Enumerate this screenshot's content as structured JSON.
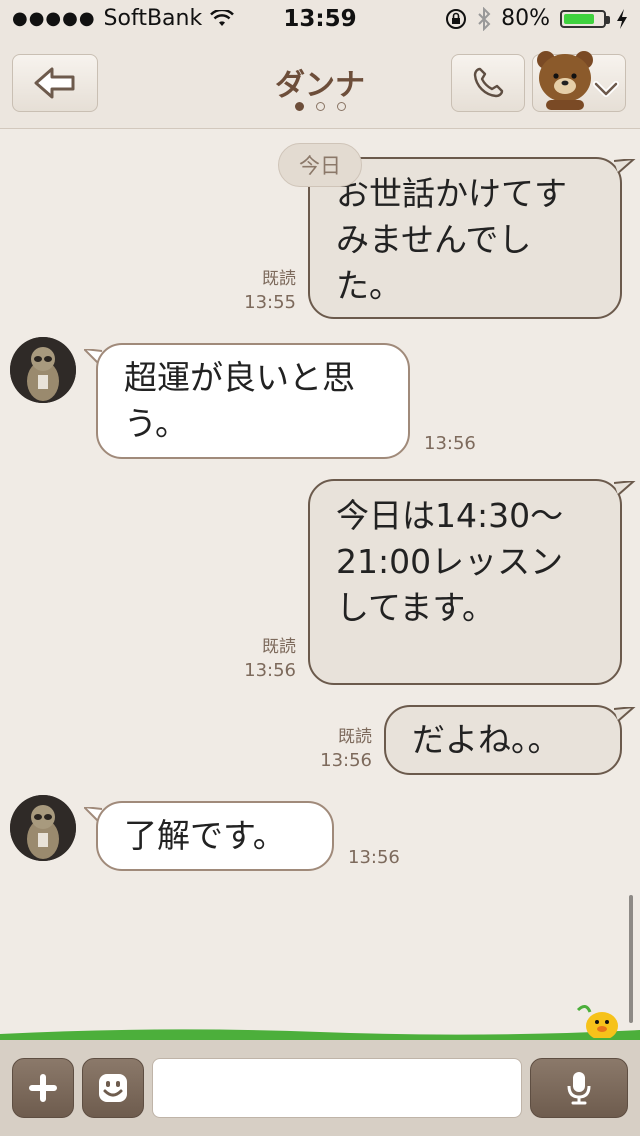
{
  "status_bar": {
    "signal_dots": "●●●●●",
    "carrier": "SoftBank",
    "time": "13:59",
    "battery_percent": "80%",
    "battery_level": 0.8,
    "icons": [
      "wifi-icon",
      "rotation-lock-icon",
      "bluetooth-icon",
      "battery-icon",
      "charging-icon"
    ]
  },
  "nav": {
    "title": "ダンナ",
    "pages": 3,
    "active_page": 1,
    "icons": [
      "back-arrow-icon",
      "phone-icon",
      "bear-sticker-icon",
      "chevron-down-icon"
    ]
  },
  "chat": {
    "date_label": "今日",
    "messages": [
      {
        "direction": "out",
        "text": "お世話かけてすみませんでした。",
        "read": "既読",
        "time": "13:55"
      },
      {
        "direction": "in",
        "text": "超運が良いと思う。",
        "time": "13:56"
      },
      {
        "direction": "out",
        "text": "今日は14:30〜21:00レッスンしてます。",
        "read": "既読",
        "time": "13:56"
      },
      {
        "direction": "out",
        "text": "だよね。。",
        "read": "既読",
        "time": "13:56"
      },
      {
        "direction": "in",
        "text": "了解です。",
        "time": "13:56"
      }
    ]
  },
  "input_bar": {
    "placeholder": "",
    "icons": [
      "plus-icon",
      "emoji-icon",
      "microphone-icon"
    ]
  },
  "colors": {
    "background": "#f0ebe5",
    "brown_accent": "#6d4e3a",
    "outgoing_bubble": "#e8e2da",
    "incoming_bubble": "#ffffff",
    "grass": "#4caf3b"
  }
}
